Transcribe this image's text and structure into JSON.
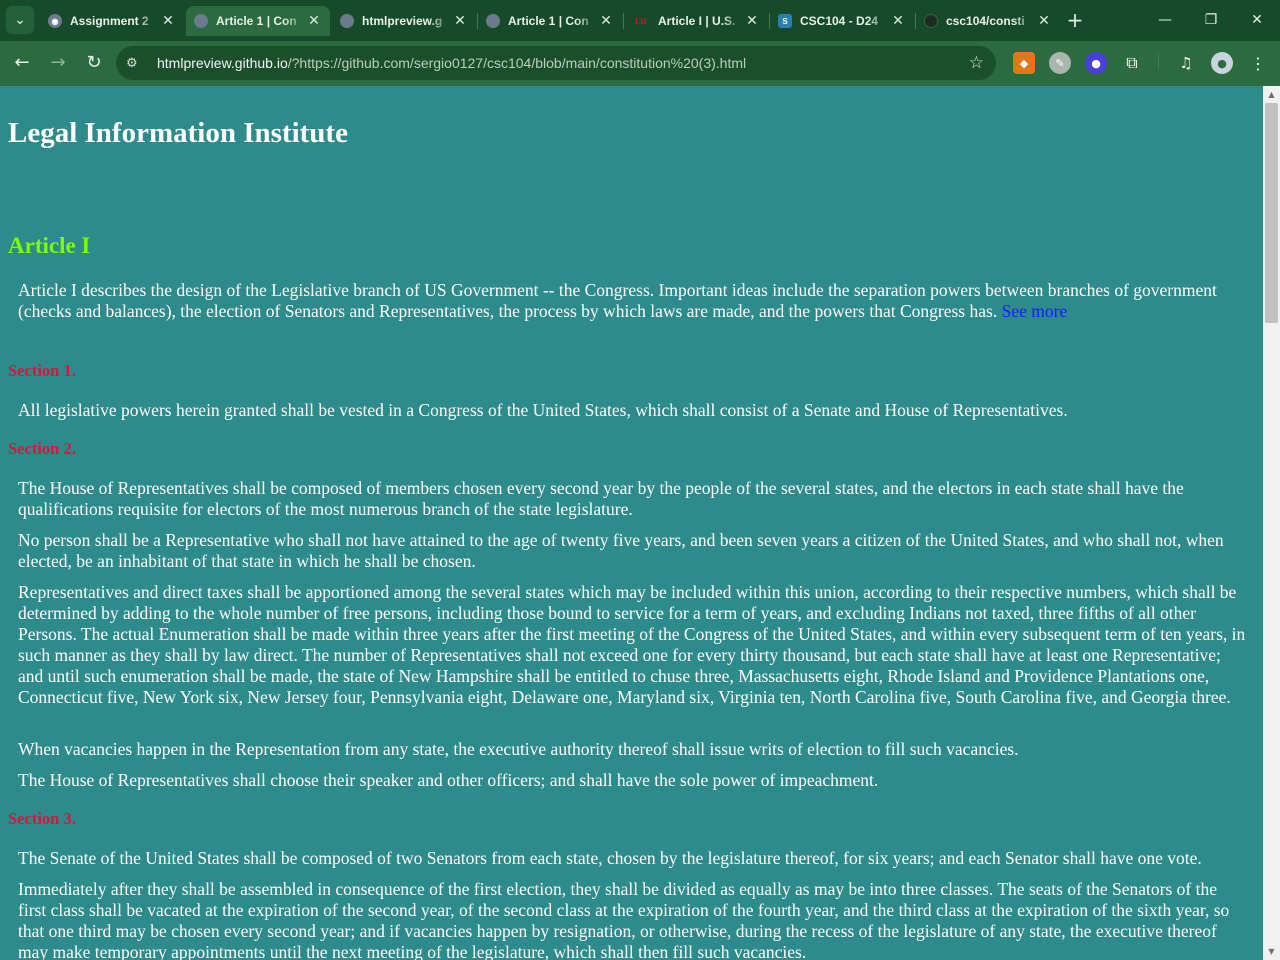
{
  "browser": {
    "tabs": [
      {
        "title": "Assignment 2",
        "active": false
      },
      {
        "title": "Article 1 | Con",
        "active": true
      },
      {
        "title": "htmlpreview.g",
        "active": false
      },
      {
        "title": "Article 1 | Con",
        "active": false
      },
      {
        "title": "Article I | U.S.",
        "favicon_text": "LII",
        "active": false
      },
      {
        "title": "CSC104 - D24",
        "active": false
      },
      {
        "title": "csc104/consti",
        "active": false
      }
    ],
    "url_host": "htmlpreview.github.io",
    "url_rest": "/?https://github.com/sergio0127/csc104/blob/main/constitution%20(3).html",
    "colors": {
      "frame": "#174a2a",
      "toolbar": "#2c6a40",
      "page_bg": "#2e8b8b",
      "heading_green": "#7cfc00",
      "section_red": "#dc143c",
      "link_blue": "#1a1aff"
    }
  },
  "page": {
    "site_title": "Legal Information Institute",
    "article_title": "Article I",
    "intro": "Article I describes the design of the Legislative branch of US Government -- the Congress. Important ideas include the separation powers between branches of government (checks and balances), the election of Senators and Representatives, the process by which laws are made, and the powers that Congress has.",
    "see_more": "See more",
    "section1": {
      "title": "Section 1.",
      "p1": "All legislative powers herein granted shall be vested in a Congress of the United States, which shall consist of a Senate and House of Representatives."
    },
    "section2": {
      "title": "Section 2.",
      "p1": "The House of Representatives shall be composed of members chosen every second year by the people of the several states, and the electors in each state shall have the qualifications requisite for electors of the most numerous branch of the state legislature.",
      "p2": "No person shall be a Representative who shall not have attained to the age of twenty five years, and been seven years a citizen of the United States, and who shall not, when elected, be an inhabitant of that state in which he shall be chosen.",
      "p3": "Representatives and direct taxes shall be apportioned among the several states which may be included within this union, according to their respective numbers, which shall be determined by adding to the whole number of free persons, including those bound to service for a term of years, and excluding Indians not taxed, three fifths of all other Persons. The actual Enumeration shall be made within three years after the first meeting of the Congress of the United States, and within every subsequent term of ten years, in such manner as they shall by law direct. The number of Representatives shall not exceed one for every thirty thousand, but each state shall have at least one Representative; and until such enumeration shall be made, the state of New Hampshire shall be entitled to chuse three, Massachusetts eight, Rhode Island and Providence Plantations one, Connecticut five, New York six, New Jersey four, Pennsylvania eight, Delaware one, Maryland six, Virginia ten, North Carolina five, South Carolina five, and Georgia three.",
      "p4": "When vacancies happen in the Representation from any state, the executive authority thereof shall issue writs of election to fill such vacancies.",
      "p5": "The House of Representatives shall choose their speaker and other officers; and shall have the sole power of impeachment."
    },
    "section3": {
      "title": "Section 3.",
      "p1": "The Senate of the United States shall be composed of two Senators from each state, chosen by the legislature thereof, for six years; and each Senator shall have one vote.",
      "p2": "Immediately after they shall be assembled in consequence of the first election, they shall be divided as equally as may be into three classes. The seats of the Senators of the first class shall be vacated at the expiration of the second year, of the second class at the expiration of the fourth year, and the third class at the expiration of the sixth year, so that one third may be chosen every second year; and if vacancies happen by resignation, or otherwise, during the recess of the legislature of any state, the executive thereof may make temporary appointments until the next meeting of the legislature, which shall then fill such vacancies."
    }
  }
}
